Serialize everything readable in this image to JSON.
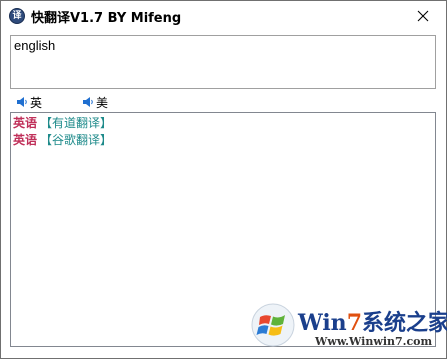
{
  "window": {
    "title": "快翻译V1.7 BY Mifeng",
    "app_icon_glyph": "译"
  },
  "input": {
    "value": "english"
  },
  "speak": {
    "uk_label": "英",
    "us_label": "美"
  },
  "results": [
    {
      "lang": "英语",
      "source": "【有道翻译】"
    },
    {
      "lang": "英语",
      "source": "【谷歌翻译】"
    }
  ],
  "watermark": {
    "brand_prefix": "Win",
    "brand_seven": "7",
    "brand_suffix": "系统之家",
    "url": "Www.Winwin7.com"
  },
  "colors": {
    "lang_label": "#c0305a",
    "source_label": "#1d8a8a",
    "brand_blue": "#1a3f8c",
    "brand_orange": "#e05010"
  },
  "icons": {
    "app": "app-logo-icon",
    "close": "close-icon",
    "speaker": "speaker-icon",
    "watermark_logo": "windows-logo-icon"
  }
}
